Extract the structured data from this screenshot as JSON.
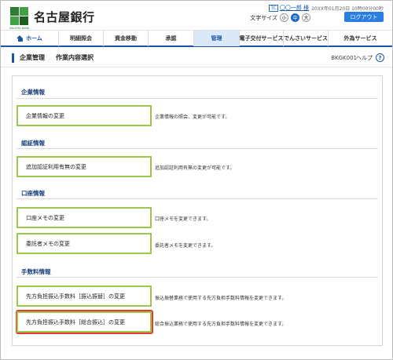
{
  "brand": {
    "name": "名古屋銀行",
    "sub": "NAGOYA BANK"
  },
  "user": {
    "badge": "TC",
    "name": "〇〇一郎 様",
    "last_login": "20XX年01月20日 10時00分00秒"
  },
  "font_size": {
    "label": "文字サイズ",
    "small": "小",
    "medium": "中",
    "large": "大",
    "selected": "中"
  },
  "logout_label": "ログアウト",
  "nav": {
    "items": [
      {
        "label": "ホーム"
      },
      {
        "label": "明細照会"
      },
      {
        "label": "資金移動"
      },
      {
        "label": "承認"
      },
      {
        "label": "管理"
      },
      {
        "label": "電子交付サービス"
      },
      {
        "label": "でんさいサービス"
      },
      {
        "label": "外為サービス"
      }
    ],
    "active": "管理"
  },
  "page": {
    "title": "企業管理",
    "subtitle": "作業内容選択",
    "screen_id": "BKGK001",
    "help_label": "ヘルプ"
  },
  "sections": [
    {
      "title": "企業情報",
      "items": [
        {
          "button": "企業情報の変更",
          "description": "企業情報の照会、変更が可能です。"
        }
      ]
    },
    {
      "title": "認証情報",
      "items": [
        {
          "button": "追加認証利用有無の変更",
          "description": "追加認証利用有無の変更が可能です。"
        }
      ]
    },
    {
      "title": "口座情報",
      "items": [
        {
          "button": "口座メモの変更",
          "description": "口座メモを変更できます。"
        },
        {
          "button": "委託者メモの変更",
          "description": "委託者メモを変更できます。"
        }
      ]
    },
    {
      "title": "手数料情報",
      "items": [
        {
          "button": "先方負担振込手数料［振込振替］の変更",
          "description": "振込振替業務で使用する先方負担手数料情報を変更できます。"
        },
        {
          "button": "先方負担振込手数料［総合振込］の変更",
          "description": "総合振込業務で使用する先方負担手数料情報を変更できます。"
        }
      ]
    }
  ],
  "colors": {
    "accent": "#1a56a8",
    "button_border": "#9cc84a",
    "highlight": "#e53935",
    "logout": "#2a7de1"
  }
}
